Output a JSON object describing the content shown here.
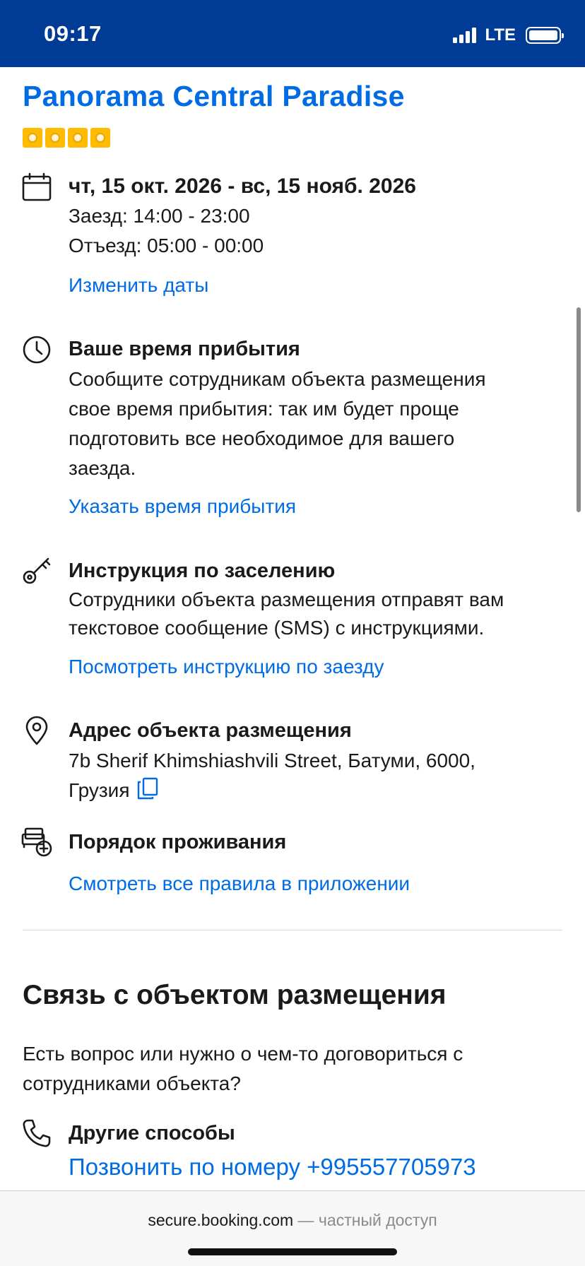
{
  "status_bar": {
    "time": "09:17",
    "network": "LTE"
  },
  "hotel": {
    "name": "Panorama Central Paradise",
    "stars": 4
  },
  "dates": {
    "range": "чт, 15 окт. 2026 - вс, 15 нояб. 2026",
    "checkin": "Заезд: 14:00 - 23:00",
    "checkout": "Отъезд: 05:00 - 00:00",
    "change_link": "Изменить даты"
  },
  "arrival": {
    "title": "Ваше время прибытия",
    "lines": [
      "Сообщите сотрудникам объекта размещения",
      "свое время прибытия: так им будет проще",
      "подготовить все необходимое для вашего",
      "заезда."
    ],
    "link": "Указать время прибытия"
  },
  "checkin_instructions": {
    "title": "Инструкция по заселению",
    "lines": [
      "Сотрудники объекта размещения отправят вам",
      "текстовое сообщение (SMS) с инструкциями."
    ],
    "link": "Посмотреть инструкцию по заезду"
  },
  "address": {
    "title": "Адрес объекта размещения",
    "line1": "7b Sherif Khimshiashvili Street, Батуми, 6000,",
    "line2": "Грузия"
  },
  "house_rules": {
    "title": "Порядок проживания",
    "link": "Смотреть все правила в приложении"
  },
  "contact": {
    "title": "Связь с объектом размещения",
    "lines": [
      "Есть вопрос или нужно о чем-то договориться с",
      "сотрудниками объекта?"
    ],
    "other_title": "Другие способы",
    "call_link": "Позвонить по номеру +995557705973"
  },
  "browser": {
    "host": "secure.booking.com",
    "private": " — частный доступ"
  },
  "icons": {
    "calendar": "calendar-icon",
    "clock": "clock-icon",
    "key": "key-icon",
    "location": "location-pin-icon",
    "rules": "house-rules-icon",
    "phone": "phone-icon",
    "copy": "copy-icon"
  },
  "colors": {
    "header": "#003b95",
    "link": "#006ce4",
    "star": "#febb02"
  }
}
